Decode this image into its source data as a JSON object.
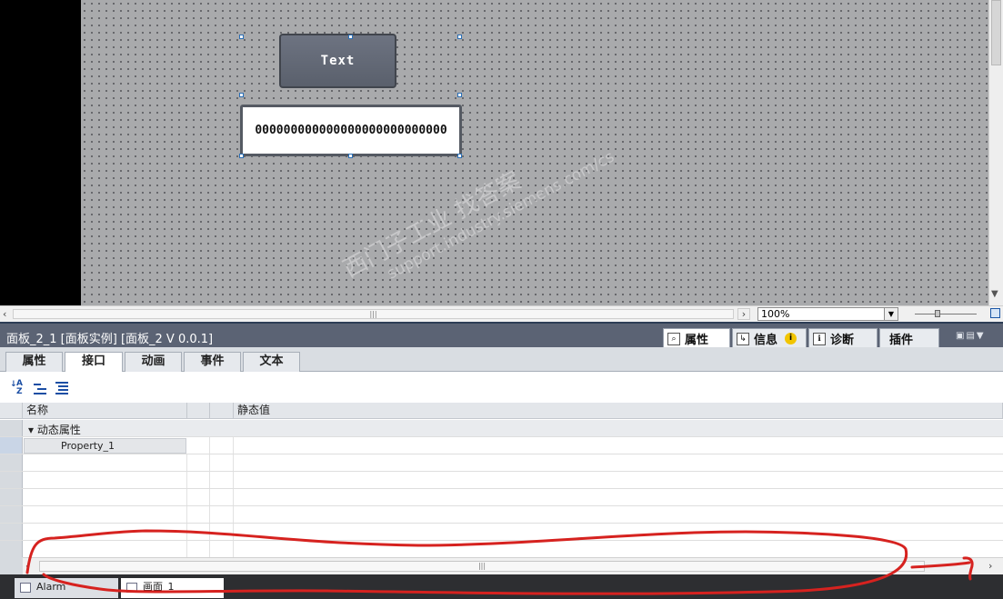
{
  "canvas": {
    "button_label": "Text",
    "io_field_value": "000000000000000000000000000"
  },
  "zoom": {
    "value": "100%",
    "slider_fraction": 0.35
  },
  "inspector": {
    "title": "面板_2_1 [面板实例] [面板_2 V 0.0.1]",
    "top_tabs": [
      {
        "label": "属性",
        "icon": "properties-icon",
        "active": true
      },
      {
        "label": "信息",
        "icon": "info-icon",
        "badge": "i"
      },
      {
        "label": "诊断",
        "icon": "diagnostics-icon"
      },
      {
        "label": "插件",
        "icon": "plugins-icon"
      }
    ],
    "sub_tabs": [
      {
        "label": "属性"
      },
      {
        "label": "接口",
        "active": true
      },
      {
        "label": "动画"
      },
      {
        "label": "事件"
      },
      {
        "label": "文本"
      }
    ],
    "toolbar": [
      "sort-az-icon",
      "collapse-icon",
      "expand-all-icon"
    ],
    "table": {
      "headers": [
        "名称",
        "静态值"
      ],
      "group": "动态属性",
      "rows": [
        "Property_1"
      ]
    }
  },
  "editor_bar": {
    "tabs": [
      {
        "label": "Alarm"
      },
      {
        "label": "画面_1"
      }
    ]
  },
  "watermark": {
    "line1": "西门子工业  找答案",
    "line2": "support.industry.siemens.com/cs"
  },
  "colors": {
    "canvas_bg": "#a9aaac",
    "title_bar": "#5b6374",
    "annotation": "#d6221f"
  }
}
